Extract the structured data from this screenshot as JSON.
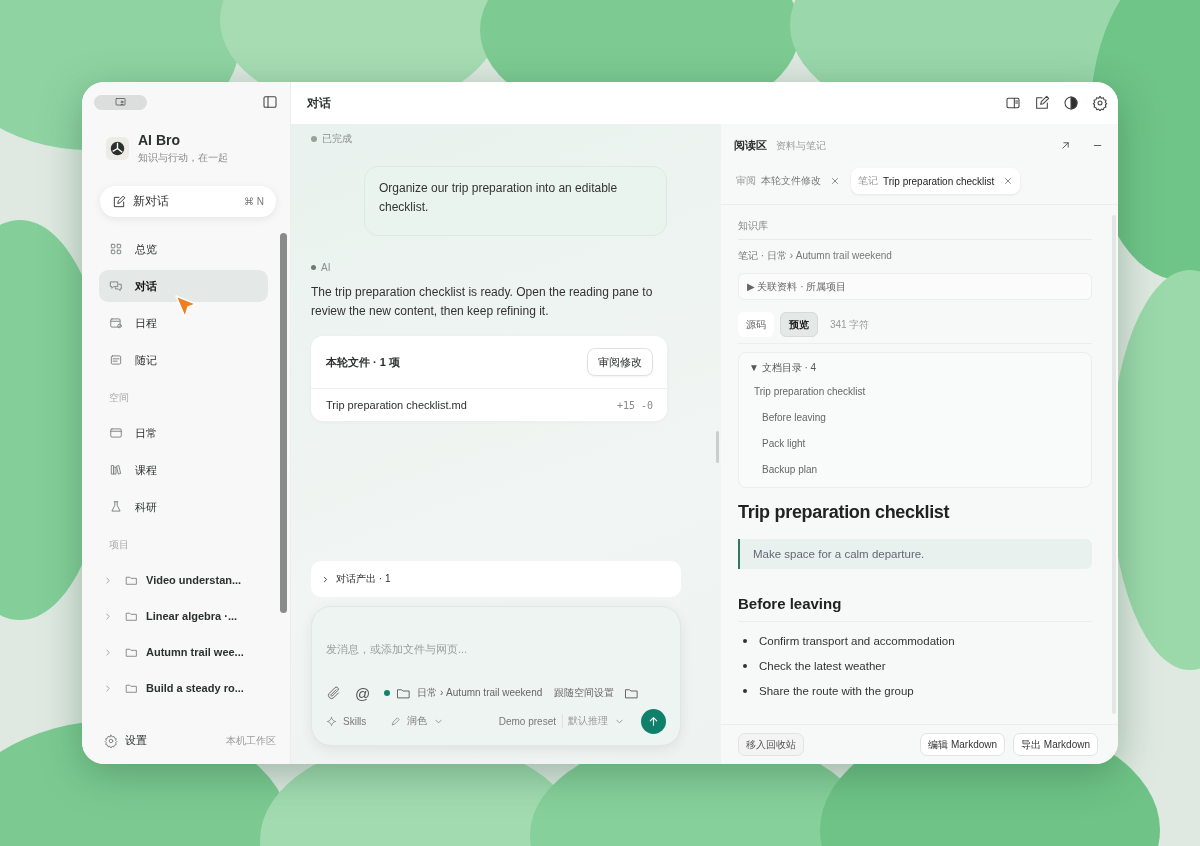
{
  "sidebar": {
    "brand": {
      "name": "AI Bro",
      "tagline": "知识与行动，在一起"
    },
    "new_chat": {
      "label": "新对话",
      "shortcut": "⌘ N"
    },
    "nav": [
      {
        "label": "总览",
        "selected": false
      },
      {
        "label": "对话",
        "selected": true
      },
      {
        "label": "日程",
        "selected": false
      },
      {
        "label": "随记",
        "selected": false
      }
    ],
    "spaces": {
      "title": "空间",
      "items": [
        {
          "label": "日常"
        },
        {
          "label": "课程"
        },
        {
          "label": "科研"
        }
      ]
    },
    "projects": {
      "title": "项目",
      "items": [
        {
          "label": "Video understan...",
          "expanded": false
        },
        {
          "label": "Linear algebra ·...",
          "expanded": false
        },
        {
          "label": "Autumn trail wee...",
          "expanded": false
        },
        {
          "label": "Build a steady ro...",
          "expanded": false
        }
      ]
    },
    "footer": {
      "settings": "设置",
      "workspace": "本机工作区"
    }
  },
  "header": {
    "title": "对话"
  },
  "chat": {
    "status": "已完成",
    "user_message": "Organize our trip preparation into an editable checklist.",
    "ai_label": "AI",
    "ai_message": "The trip preparation checklist is ready. Open the reading pane to review the new content, then keep refining it.",
    "files_card": {
      "title": "本轮文件 · 1 项",
      "review_button": "审阅修改",
      "files": [
        {
          "name": "Trip preparation checklist.md",
          "diff": "+15 -0"
        }
      ]
    },
    "outputs": {
      "label": "对话产出 · 1",
      "expanded": false
    }
  },
  "composer": {
    "placeholder": "发消息，或添加文件与网页...",
    "mention": "@",
    "context": "日常 › Autumn trail weekend",
    "follow": "跟随空间设置",
    "skills": "Skills",
    "polish": "润色",
    "preset": "Demo preset",
    "reasoning": "默认推理"
  },
  "reader": {
    "title": "阅读区",
    "subtitle": "资料与笔记",
    "tabs": [
      {
        "tag": "审阅",
        "label": "本轮文件修改",
        "selected": false
      },
      {
        "tag": "笔记",
        "label": "Trip preparation checklist",
        "selected": true
      }
    ],
    "section_label": "知识库",
    "path": "笔记 · 日常 › Autumn trail weekend",
    "related": "▶ 关联资料 · 所属项目",
    "modes": [
      {
        "label": "源码",
        "selected": false
      },
      {
        "label": "预览",
        "selected": true
      }
    ],
    "char_count": "341 字符",
    "toc": {
      "title": "▼ 文档目录 · 4",
      "expanded": true,
      "items": [
        {
          "label": "Trip preparation checklist",
          "children": [
            {
              "label": "Before leaving"
            },
            {
              "label": "Pack light"
            },
            {
              "label": "Backup plan"
            }
          ]
        }
      ]
    },
    "document": {
      "title": "Trip preparation checklist",
      "quote": "Make space for a calm departure.",
      "sections": [
        {
          "heading": "Before leaving",
          "bullets": [
            "Confirm transport and accommodation",
            "Check the latest weather",
            "Share the route with the group"
          ]
        }
      ]
    },
    "actions": {
      "trash": "移入回收站",
      "edit": "编辑 Markdown",
      "export": "导出 Markdown"
    }
  }
}
